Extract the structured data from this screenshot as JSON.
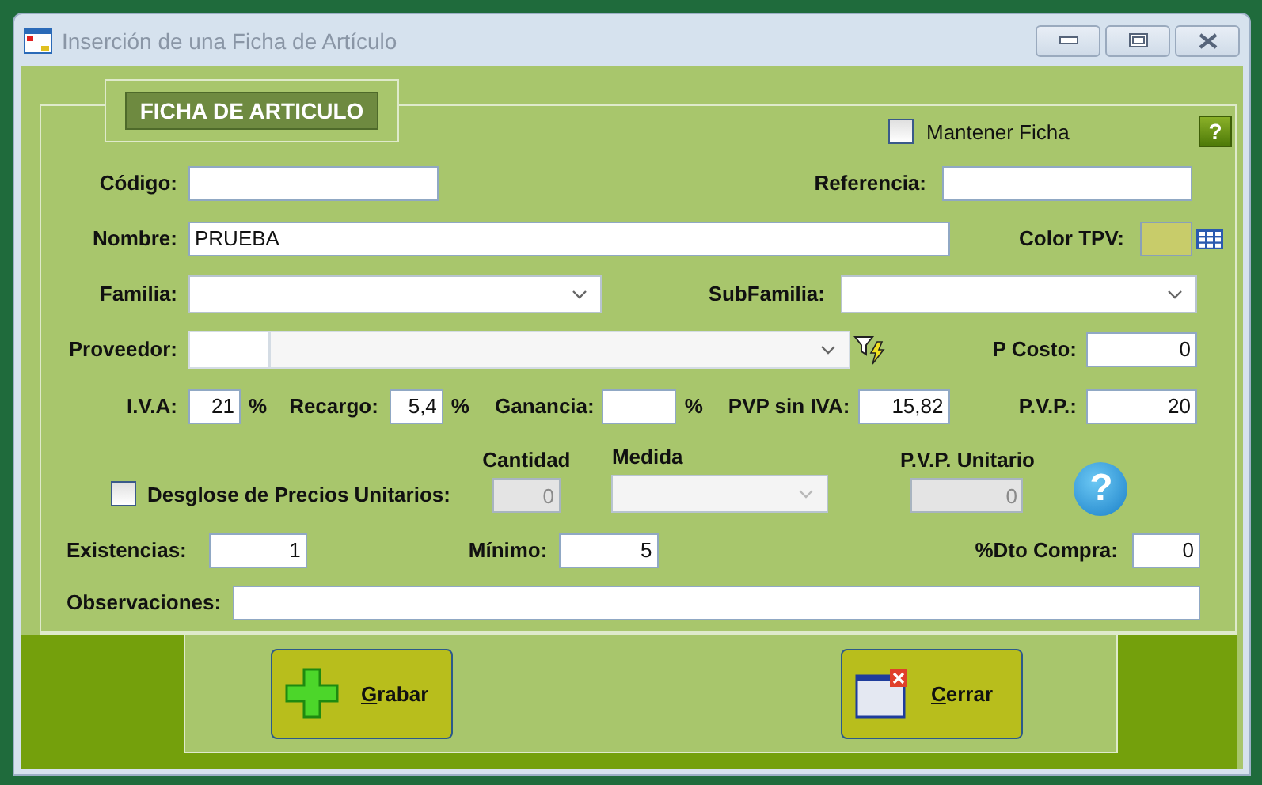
{
  "window": {
    "title": "Inserción de una Ficha de Artículo"
  },
  "group_title": "FICHA DE ARTICULO",
  "mantener_ficha": {
    "label": "Mantener Ficha",
    "checked": false
  },
  "help_button": {
    "glyph": "?"
  },
  "codigo": {
    "label": "Código:"
  },
  "referencia": {
    "label": "Referencia:"
  },
  "nombre": {
    "label": "Nombre:",
    "value": "PRUEBA"
  },
  "color_tpv": {
    "label": "Color TPV:",
    "color": "#c8cc6a"
  },
  "familia": {
    "label": "Familia:"
  },
  "subfamilia": {
    "label": "SubFamilia:"
  },
  "proveedor": {
    "label": "Proveedor:"
  },
  "p_costo": {
    "label": "P Costo:",
    "value": "0"
  },
  "iva": {
    "label": "I.V.A:",
    "value": "21",
    "unit": "%"
  },
  "recargo": {
    "label": "Recargo:",
    "value": "5,4",
    "unit": "%"
  },
  "ganancia": {
    "label": "Ganancia:",
    "unit": "%"
  },
  "pvp_sin_iva": {
    "label": "PVP sin IVA:",
    "value": "15,82"
  },
  "pvp": {
    "label": "P.V.P.:",
    "value": "20"
  },
  "desglose": {
    "label": "Desglose de Precios Unitarios:",
    "checked": false
  },
  "cantidad": {
    "label": "Cantidad",
    "value": "0",
    "disabled": true
  },
  "medida": {
    "label": "Medida",
    "disabled": true
  },
  "pvp_unitario": {
    "label": "P.V.P. Unitario",
    "value": "0",
    "disabled": true
  },
  "info_button": {
    "glyph": "?"
  },
  "existencias": {
    "label": "Existencias:",
    "value": "1"
  },
  "minimo": {
    "label": "Mínimo:",
    "value": "5"
  },
  "dto_compra": {
    "label": "%Dto Compra:",
    "value": "0"
  },
  "observaciones": {
    "label": "Observaciones:"
  },
  "buttons": [
    {
      "label": "Grabar",
      "kind": "save"
    },
    {
      "label": "Cerrar",
      "kind": "close"
    }
  ]
}
